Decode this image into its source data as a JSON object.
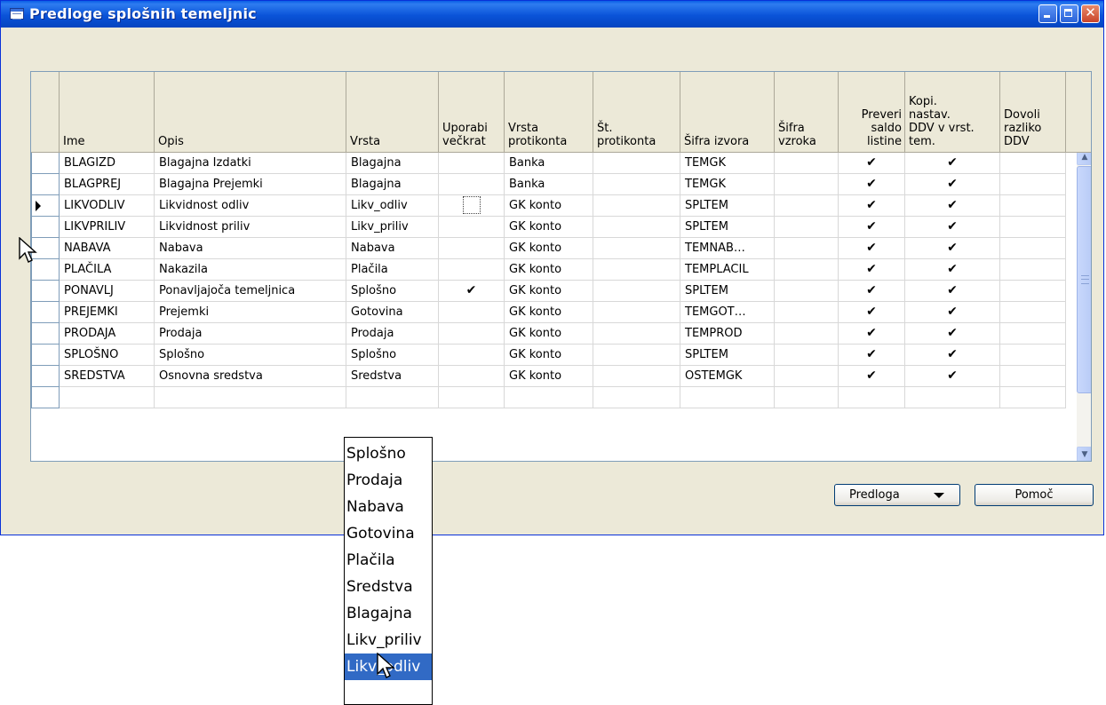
{
  "window": {
    "title": "Predloge splošnih temeljnic",
    "controls": {
      "minimize": "minimize",
      "maximize": "maximize",
      "close": "✕"
    }
  },
  "grid": {
    "columns": [
      {
        "key": "marker",
        "label": ""
      },
      {
        "key": "ime",
        "label": "Ime"
      },
      {
        "key": "opis",
        "label": "Opis"
      },
      {
        "key": "vrsta",
        "label": "Vrsta"
      },
      {
        "key": "uporabi",
        "label": "Uporabi\nvečkrat"
      },
      {
        "key": "vrsta_prot",
        "label": "Vrsta\nprotikonta"
      },
      {
        "key": "st_prot",
        "label": "Št.\nprotikonta"
      },
      {
        "key": "sifra_izvora",
        "label": "Šifra izvora"
      },
      {
        "key": "sifra_vzroka",
        "label": "Šifra\nvzroka"
      },
      {
        "key": "preveri",
        "label": "Preveri\nsaldo\nlistine"
      },
      {
        "key": "kopi",
        "label": "Kopi.\nnastav.\nDDV v vrst.\ntem."
      },
      {
        "key": "dovoli",
        "label": "Dovoli\nrazliko\nDDV"
      }
    ],
    "rows": [
      {
        "ime": "BLAGIZD",
        "opis": "Blagajna Izdatki",
        "vrsta": "Blagajna",
        "uporabi": "",
        "vrsta_prot": "Banka",
        "st_prot": "",
        "sifra_izvora": "TEMGK",
        "sifra_vzroka": "",
        "preveri": "✔",
        "kopi": "✔",
        "dovoli": ""
      },
      {
        "ime": "BLAGPREJ",
        "opis": "Blagajna Prejemki",
        "vrsta": "Blagajna",
        "uporabi": "",
        "vrsta_prot": "Banka",
        "st_prot": "",
        "sifra_izvora": "TEMGK",
        "sifra_vzroka": "",
        "preveri": "✔",
        "kopi": "✔",
        "dovoli": ""
      },
      {
        "ime": "LIKVODLIV",
        "opis": "Likvidnost odliv",
        "vrsta": "Likv_odliv",
        "uporabi": "",
        "vrsta_prot": "GK konto",
        "st_prot": "",
        "sifra_izvora": "SPLTEM",
        "sifra_vzroka": "",
        "preveri": "✔",
        "kopi": "✔",
        "dovoli": ""
      },
      {
        "ime": "LIKVPRILIV",
        "opis": "Likvidnost priliv",
        "vrsta": "Likv_priliv",
        "uporabi": "",
        "vrsta_prot": "GK konto",
        "st_prot": "",
        "sifra_izvora": "SPLTEM",
        "sifra_vzroka": "",
        "preveri": "✔",
        "kopi": "✔",
        "dovoli": ""
      },
      {
        "ime": "NABAVA",
        "opis": "Nabava",
        "vrsta": "Nabava",
        "uporabi": "",
        "vrsta_prot": "GK konto",
        "st_prot": "",
        "sifra_izvora": "TEMNAB…",
        "sifra_vzroka": "",
        "preveri": "✔",
        "kopi": "✔",
        "dovoli": ""
      },
      {
        "ime": "PLAČILA",
        "opis": "Nakazila",
        "vrsta": "Plačila",
        "uporabi": "",
        "vrsta_prot": "GK konto",
        "st_prot": "",
        "sifra_izvora": "TEMPLACIL",
        "sifra_vzroka": "",
        "preveri": "✔",
        "kopi": "✔",
        "dovoli": ""
      },
      {
        "ime": "PONAVLJ",
        "opis": "Ponavljajoča temeljnica",
        "vrsta": "Splošno",
        "uporabi": "✔",
        "vrsta_prot": "GK konto",
        "st_prot": "",
        "sifra_izvora": "SPLTEM",
        "sifra_vzroka": "",
        "preveri": "✔",
        "kopi": "✔",
        "dovoli": ""
      },
      {
        "ime": "PREJEMKI",
        "opis": "Prejemki",
        "vrsta": "Gotovina",
        "uporabi": "",
        "vrsta_prot": "GK konto",
        "st_prot": "",
        "sifra_izvora": "TEMGOT…",
        "sifra_vzroka": "",
        "preveri": "✔",
        "kopi": "✔",
        "dovoli": ""
      },
      {
        "ime": "PRODAJA",
        "opis": "Prodaja",
        "vrsta": "Prodaja",
        "uporabi": "",
        "vrsta_prot": "GK konto",
        "st_prot": "",
        "sifra_izvora": "TEMPROD",
        "sifra_vzroka": "",
        "preveri": "✔",
        "kopi": "✔",
        "dovoli": ""
      },
      {
        "ime": "SPLOŠNO",
        "opis": "Splošno",
        "vrsta": "Splošno",
        "uporabi": "",
        "vrsta_prot": "GK konto",
        "st_prot": "",
        "sifra_izvora": "SPLTEM",
        "sifra_vzroka": "",
        "preveri": "✔",
        "kopi": "✔",
        "dovoli": ""
      },
      {
        "ime": "SREDSTVA",
        "opis": "Osnovna sredstva",
        "vrsta": "Sredstva",
        "uporabi": "",
        "vrsta_prot": "GK konto",
        "st_prot": "",
        "sifra_izvora": "OSTEMGK",
        "sifra_vzroka": "",
        "preveri": "✔",
        "kopi": "✔",
        "dovoli": ""
      },
      {
        "ime": "",
        "opis": "",
        "vrsta": "",
        "uporabi": "",
        "vrsta_prot": "",
        "st_prot": "",
        "sifra_izvora": "",
        "sifra_vzroka": "",
        "preveri": "",
        "kopi": "",
        "dovoli": ""
      }
    ],
    "current_row_index": 2
  },
  "buttons": {
    "predloga_label": "Predloga",
    "pomoc_label": "Pomoč"
  },
  "dropdown": {
    "options": [
      "Splošno",
      "Prodaja",
      "Nabava",
      "Gotovina",
      "Plačila",
      "Sredstva",
      "Blagajna",
      "Likv_priliv",
      "Likv_odliv"
    ],
    "selected_index": 8
  },
  "colors": {
    "titlebar": "#0a53d8",
    "window_bg": "#ece9d8",
    "selection": "#316ac5"
  }
}
